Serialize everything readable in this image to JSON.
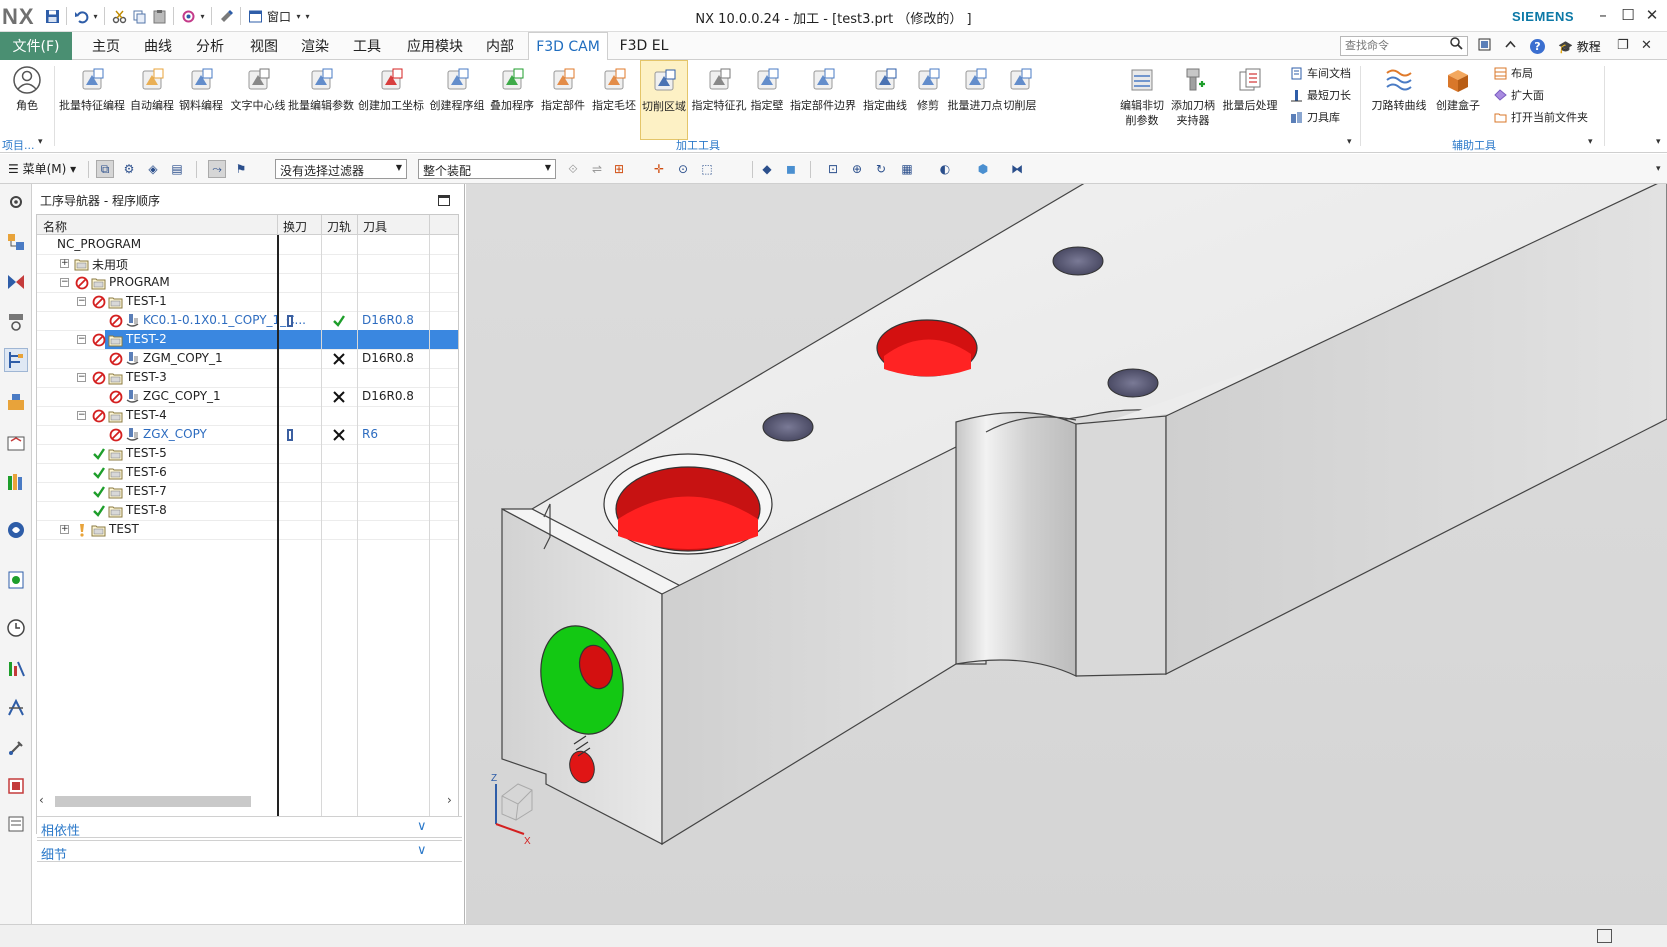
{
  "app": {
    "logo": "NX",
    "window_title": "NX 10.0.0.24 - 加工 - [test3.prt （修改的） ]",
    "brand": "SIEMENS",
    "window_menu": "窗口"
  },
  "menubar": {
    "file": "文件(F)",
    "tabs": [
      "主页",
      "曲线",
      "分析",
      "视图",
      "渲染",
      "工具",
      "应用模块",
      "内部",
      "F3D CAM",
      "F3D EL"
    ],
    "active_tab": "F3D CAM",
    "search_placeholder": "查找命令",
    "tutorial": "教程"
  },
  "ribbon": {
    "role": "角色",
    "project_group": "项目...",
    "buttons": [
      "批量特征编程",
      "自动编程",
      "钢料编程",
      "文字中心线",
      "批量编辑参数",
      "创建加工坐标",
      "创建程序组",
      "叠加程序",
      "指定部件",
      "指定毛坯",
      "切削区域",
      "指定特征孔",
      "指定壁",
      "指定部件边界",
      "指定曲线",
      "修剪",
      "批量进刀点",
      "切削层"
    ],
    "button_edit_noncut": [
      "编辑非切",
      "削参数"
    ],
    "button_add_holder": [
      "添加刀柄",
      "夹持器"
    ],
    "button_batch_post": "批量后处理",
    "small_buttons_1": [
      "车间文档",
      "最短刀长",
      "刀具库"
    ],
    "group_label_1": "加工工具",
    "aux_buttons": [
      "刀路转曲线",
      "创建盒子"
    ],
    "small_buttons_2": [
      "布局",
      "扩大面",
      "打开当前文件夹"
    ],
    "group_label_2": "辅助工具"
  },
  "toolbar": {
    "menu": "菜单(M)",
    "filter_value": "没有选择过滤器",
    "assembly_value": "整个装配"
  },
  "navigator": {
    "title": "工序导航器 - 程序顺序",
    "columns": [
      "名称",
      "换刀",
      "刀轨",
      "刀具"
    ],
    "rows": [
      {
        "name": "NC_PROGRAM",
        "level": 0,
        "expander": "",
        "status": "none",
        "type": "root",
        "tool": "",
        "toolchange": false,
        "path": ""
      },
      {
        "name": "未用项",
        "level": 1,
        "expander": "+",
        "status": "none",
        "type": "folder",
        "tool": "",
        "toolchange": false,
        "path": ""
      },
      {
        "name": "PROGRAM",
        "level": 1,
        "expander": "-",
        "status": "stop",
        "type": "folder",
        "tool": "",
        "toolchange": false,
        "path": ""
      },
      {
        "name": "TEST-1",
        "level": 2,
        "expander": "-",
        "status": "stop",
        "type": "folder",
        "tool": "",
        "toolchange": false,
        "path": ""
      },
      {
        "name": "KC0.1-0.1X0.1_COPY_1_C...",
        "level": 3,
        "expander": "",
        "status": "stop",
        "type": "op",
        "tool": "D16R0.8",
        "toolchange": true,
        "path": "check"
      },
      {
        "name": "TEST-2",
        "level": 2,
        "expander": "-",
        "status": "stop",
        "type": "folder",
        "tool": "",
        "toolchange": false,
        "path": "",
        "selected": true
      },
      {
        "name": "ZGM_COPY_1",
        "level": 3,
        "expander": "",
        "status": "stop",
        "type": "op-plain",
        "tool": "D16R0.8",
        "toolchange": false,
        "path": "cross"
      },
      {
        "name": "TEST-3",
        "level": 2,
        "expander": "-",
        "status": "stop",
        "type": "folder",
        "tool": "",
        "toolchange": false,
        "path": ""
      },
      {
        "name": "ZGC_COPY_1",
        "level": 3,
        "expander": "",
        "status": "stop",
        "type": "op-plain",
        "tool": "D16R0.8",
        "toolchange": false,
        "path": "cross"
      },
      {
        "name": "TEST-4",
        "level": 2,
        "expander": "-",
        "status": "stop",
        "type": "folder",
        "tool": "",
        "toolchange": false,
        "path": ""
      },
      {
        "name": "ZGX_COPY",
        "level": 3,
        "expander": "",
        "status": "stop",
        "type": "op",
        "tool": "R6",
        "toolchange": true,
        "path": "cross"
      },
      {
        "name": "TEST-5",
        "level": 2,
        "expander": "",
        "status": "ok",
        "type": "folder",
        "tool": "",
        "toolchange": false,
        "path": ""
      },
      {
        "name": "TEST-6",
        "level": 2,
        "expander": "",
        "status": "ok",
        "type": "folder",
        "tool": "",
        "toolchange": false,
        "path": ""
      },
      {
        "name": "TEST-7",
        "level": 2,
        "expander": "",
        "status": "ok",
        "type": "folder",
        "tool": "",
        "toolchange": false,
        "path": ""
      },
      {
        "name": "TEST-8",
        "level": 2,
        "expander": "",
        "status": "ok",
        "type": "folder",
        "tool": "",
        "toolchange": false,
        "path": ""
      },
      {
        "name": "TEST",
        "level": 1,
        "expander": "+",
        "status": "warn",
        "type": "folder",
        "tool": "",
        "toolchange": false,
        "path": ""
      }
    ],
    "panel_dependencies": "相依性",
    "panel_details": "细节"
  },
  "viewport": {
    "axis_z": "Z",
    "axis_x": "X"
  },
  "colors": {
    "accent_green": "#4a8f72",
    "selection_blue": "#3a87e0",
    "link_blue": "#2a78c9",
    "stop_red": "#d42020",
    "ok_green": "#1e9e2b",
    "hole_red": "#ff1a1a",
    "face_green": "#1fd61f"
  },
  "icons": {
    "qa": [
      "save-icon",
      "undo-icon",
      "cut-icon",
      "copy-icon",
      "paste-icon",
      "repeat-command-icon",
      "touch-mode-icon",
      "window-icon"
    ],
    "resource_bar": [
      "settings-icon",
      "assembly-navigator-icon",
      "constraint-navigator-icon",
      "part-navigator-icon",
      "operation-navigator-icon",
      "machine-tool-navigator-icon",
      "reuse-library-icon",
      "hd3d-tools-icon",
      "internet-browser-icon",
      "history-icon",
      "process-studio-icon",
      "manufacturing-wizard-icon",
      "roles-icon",
      "system-materials-icon",
      "system-scenes-icon"
    ]
  }
}
